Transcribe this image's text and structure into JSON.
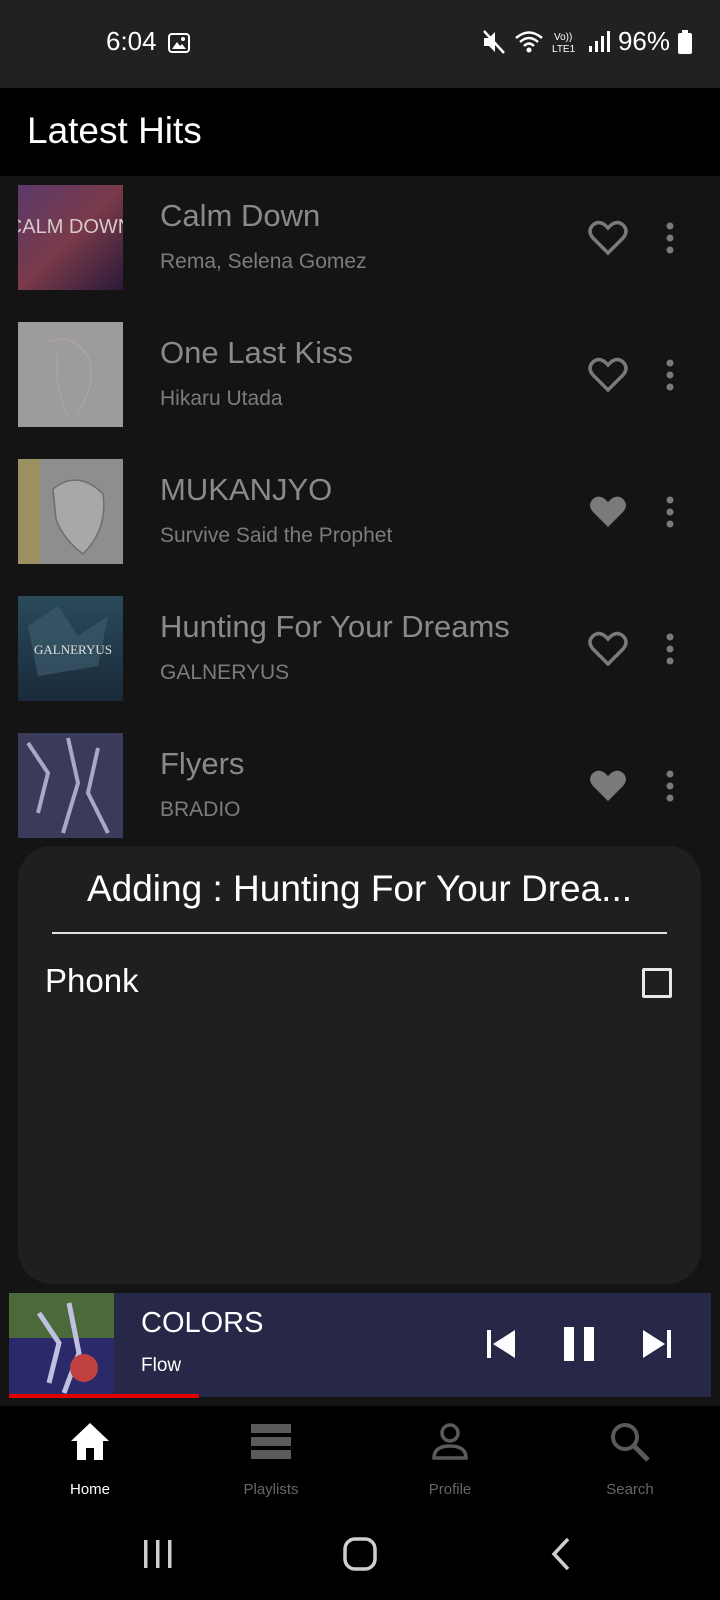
{
  "status_bar": {
    "time": "6:04",
    "battery": "96%",
    "icons": [
      "photo-icon",
      "mute-icon",
      "wifi-icon",
      "volte-icon",
      "signal-icon",
      "battery-icon"
    ]
  },
  "app_bar": {
    "title": "Latest Hits"
  },
  "songs": [
    {
      "title": "Calm Down",
      "artist": "Rema, Selena Gomez",
      "liked": false,
      "art_label": "CALM DOWN"
    },
    {
      "title": "One Last Kiss",
      "artist": "Hikaru Utada",
      "liked": false,
      "art_label": ""
    },
    {
      "title": "MUKANJYO",
      "artist": "Survive Said the Prophet",
      "liked": true,
      "art_label": ""
    },
    {
      "title": "Hunting For Your Dreams",
      "artist": "GALNERYUS",
      "liked": false,
      "art_label": "GALNERYUS"
    },
    {
      "title": "Flyers",
      "artist": "BRADIO",
      "liked": true,
      "art_label": ""
    }
  ],
  "dialog": {
    "title": "Adding : Hunting For Your Drea...",
    "playlists": [
      {
        "name": "Phonk",
        "checked": false
      }
    ]
  },
  "now_playing": {
    "title": "COLORS",
    "artist": "Flow",
    "progress_fraction": 0.27
  },
  "bottom_nav": {
    "items": [
      {
        "label": "Home",
        "icon": "home-icon",
        "active": true
      },
      {
        "label": "Playlists",
        "icon": "playlists-icon",
        "active": false
      },
      {
        "label": "Profile",
        "icon": "profile-icon",
        "active": false
      },
      {
        "label": "Search",
        "icon": "search-icon",
        "active": false
      }
    ]
  },
  "colors": {
    "accent_progress": "#e00000",
    "now_playing_bg": "#272848",
    "dialog_bg": "#1f1f1f"
  }
}
